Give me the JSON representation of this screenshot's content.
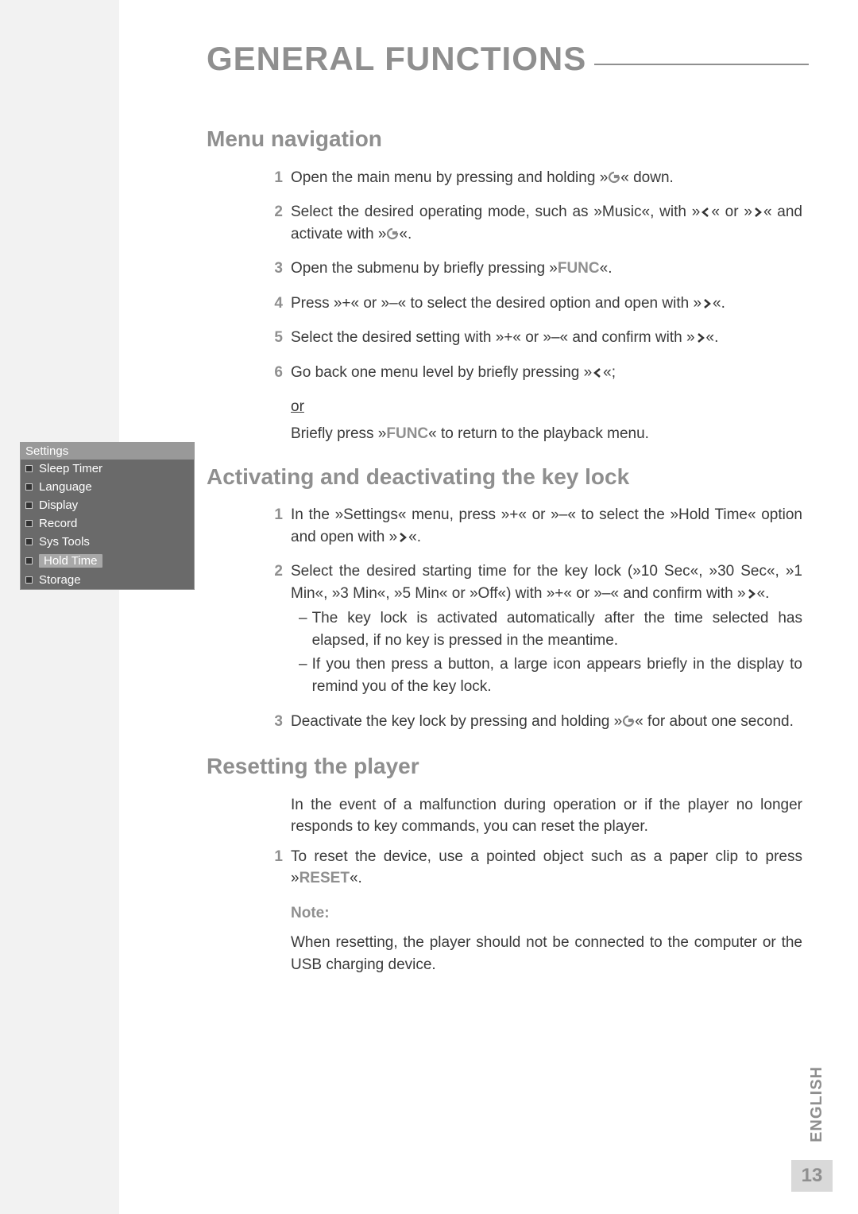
{
  "page_title": "GENERAL FUNCTIONS",
  "menu_nav": {
    "heading": "Menu navigation",
    "steps": [
      {
        "n": "1",
        "text": "Open the main menu by pressing and holding »{G}« down."
      },
      {
        "n": "2",
        "text": "Select the desired operating mode, such as »Music«, with »{LT}« or »{GT}« and activate with »{G}«."
      },
      {
        "n": "3",
        "text": "Open the submenu by briefly pressing »{FUNC}«."
      },
      {
        "n": "4",
        "text": "Press »+« or »–« to select the desired option and open with »{GT}«."
      },
      {
        "n": "5",
        "text": "Select the desired setting with »+« or »–« and confirm with »{GT}«."
      },
      {
        "n": "6",
        "text": "Go back one menu level by briefly pressing »{LT}«;"
      }
    ],
    "or": "or",
    "or_text": "Briefly press »{FUNC}« to return to the playback menu."
  },
  "keylock": {
    "heading": "Activating and deactivating the key lock",
    "steps": [
      {
        "n": "1",
        "text": "In the »Settings« menu, press »+« or »–« to select the »Hold Time« option and open with »{GT}«."
      },
      {
        "n": "2",
        "text": "Select the desired starting time for the key lock (»10 Sec«, »30 Sec«, »1 Min«, »3 Min«, »5 Min« or »Off«) with »+« or »–« and confirm with »{GT}«.",
        "bullets": [
          "The key lock is activated automatically after the time selected has elapsed, if no key is pressed in the meantime.",
          "If you then press a button, a large icon appears briefly in the display to remind you of the key lock."
        ]
      },
      {
        "n": "3",
        "text": "Deactivate the key lock by pressing and holding »{G}« for about one second."
      }
    ]
  },
  "reset": {
    "heading": "Resetting the player",
    "intro": "In the event of a malfunction during operation or if the player no longer responds to key commands, you can reset the player.",
    "steps": [
      {
        "n": "1",
        "text": "To reset the device, use a pointed object such as a paper clip to press »{RESET}«."
      }
    ],
    "note_label": "Note:",
    "note": "When resetting, the player should not be connected to the computer or the USB charging device."
  },
  "sidebar": {
    "header": "Settings",
    "items": [
      {
        "label": "Sleep Timer",
        "highlight": false
      },
      {
        "label": "Language",
        "highlight": false
      },
      {
        "label": "Display",
        "highlight": false
      },
      {
        "label": "Record",
        "highlight": false
      },
      {
        "label": "Sys Tools",
        "highlight": false
      },
      {
        "label": "Hold Time",
        "highlight": true
      },
      {
        "label": "Storage",
        "highlight": false
      }
    ]
  },
  "footer": {
    "language": "ENGLISH",
    "page": "13"
  },
  "tokens": {
    "FUNC": "FUNC",
    "RESET": "RESET"
  }
}
